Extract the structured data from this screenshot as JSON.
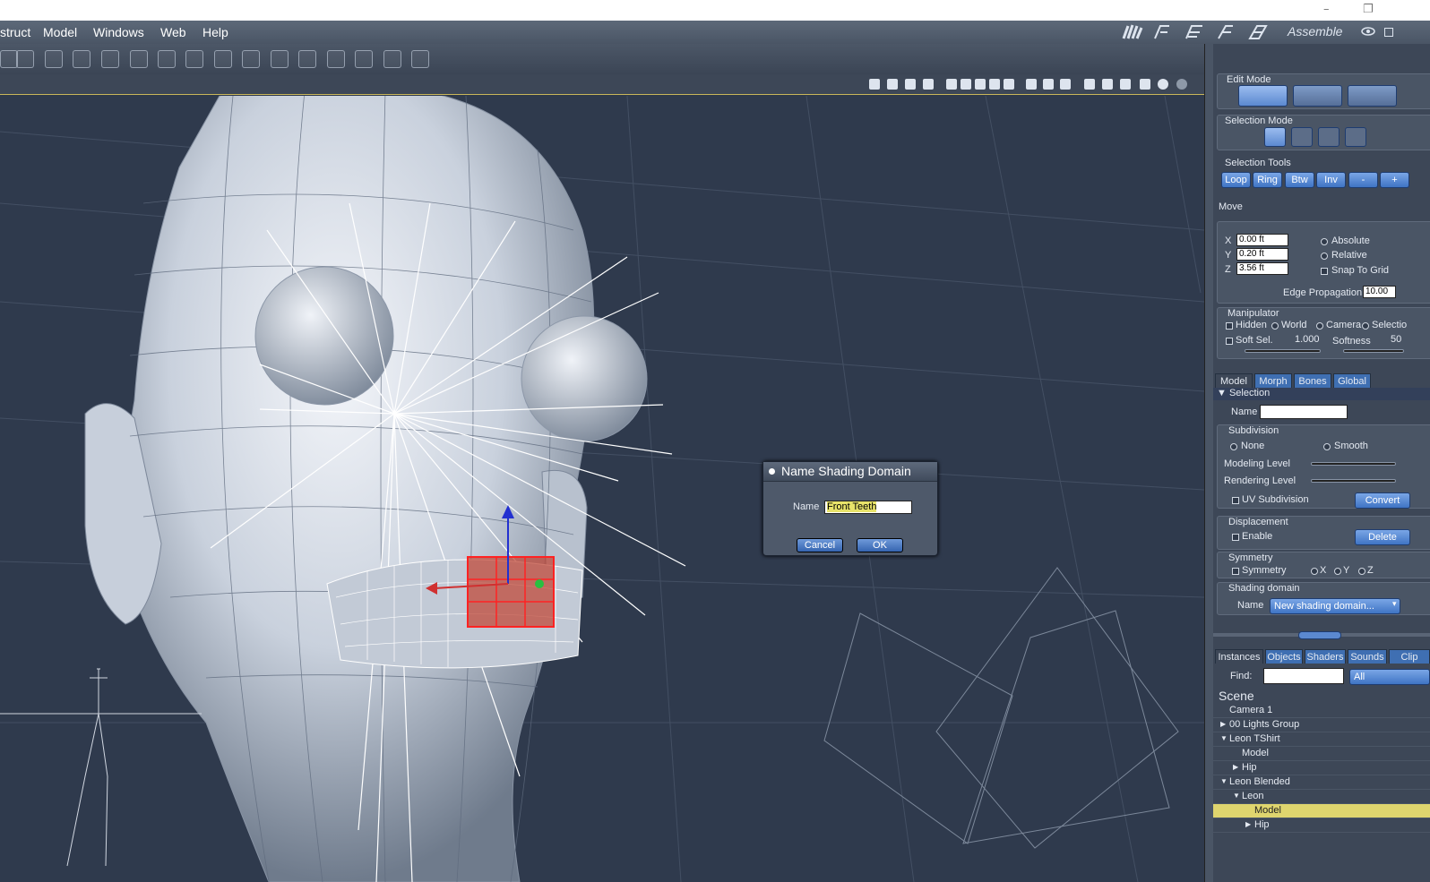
{
  "window": {
    "minimize_glyph": "–",
    "restore_glyph": "❐"
  },
  "menu": {
    "items": [
      "struct",
      "Model",
      "Windows",
      "Web",
      "Help"
    ],
    "room": "Assemble"
  },
  "toolbar": {
    "icons": [
      "move-icon",
      "scale-icon",
      "rotate-icon",
      "taper-icon",
      "twist-icon",
      "stretch-icon",
      "squash-icon",
      "dent-icon",
      "mesh-icon",
      "smooth-icon",
      "paint-icon",
      "pencil-icon",
      "brush-icon",
      "cube-icon",
      "wrap-icon",
      "bend-icon"
    ]
  },
  "edit_mode": {
    "title": "Edit Mode"
  },
  "selection_mode": {
    "title": "Selection Mode"
  },
  "selection_tools": {
    "title": "Selection Tools",
    "buttons": [
      "Loop",
      "Ring",
      "Btw",
      "Inv",
      "-",
      "+"
    ]
  },
  "move": {
    "title": "Move",
    "x": "0.00 ft",
    "y": "0.20 ft",
    "z": "3.56 ft",
    "x_label": "X",
    "y_label": "Y",
    "z_label": "Z",
    "absolute": "Absolute",
    "relative": "Relative",
    "snap": "Snap To Grid",
    "edge_prop_label": "Edge Propagation",
    "edge_prop": "10.00"
  },
  "manipulator": {
    "title": "Manipulator",
    "hidden": "Hidden",
    "world": "World",
    "camera": "Camera",
    "selection": "Selectio",
    "soft_sel": "Soft Sel.",
    "soft_val": "1.000",
    "softness": "Softness",
    "softness_val": "50"
  },
  "tabs": [
    "Model",
    "Morph",
    "Bones",
    "Global"
  ],
  "selection": {
    "header": "Selection",
    "name_label": "Name",
    "name_value": ""
  },
  "subdivision": {
    "title": "Subdivision",
    "none": "None",
    "smooth": "Smooth",
    "modeling": "Modeling Level",
    "rendering": "Rendering Level",
    "uv": "UV Subdivision",
    "convert": "Convert"
  },
  "displacement": {
    "title": "Displacement",
    "enable": "Enable",
    "delete": "Delete"
  },
  "symmetry": {
    "title": "Symmetry",
    "label": "Symmetry",
    "x": "X",
    "y": "Y",
    "z": "Z"
  },
  "shading": {
    "title": "Shading domain",
    "name_label": "Name",
    "select": "New shading domain..."
  },
  "lib_tabs": [
    "Instances",
    "Objects",
    "Shaders",
    "Sounds",
    "Clip"
  ],
  "find": {
    "label": "Find:",
    "value": "",
    "filter": "All"
  },
  "scene": {
    "title": "Scene",
    "items": [
      "Camera 1",
      "00 Lights Group",
      "Leon TShirt",
      "Model",
      "Hip",
      "Leon Blended",
      "Leon",
      "Model",
      "Hip"
    ]
  },
  "dialog": {
    "title": "Name Shading Domain",
    "name_label": "Name",
    "name_value": "Front Teeth",
    "cancel": "Cancel",
    "ok": "OK"
  },
  "colors": {
    "selected_row": "#dfd56e",
    "highlight_field": "#e8e36a",
    "accent": "#3f74c4"
  }
}
